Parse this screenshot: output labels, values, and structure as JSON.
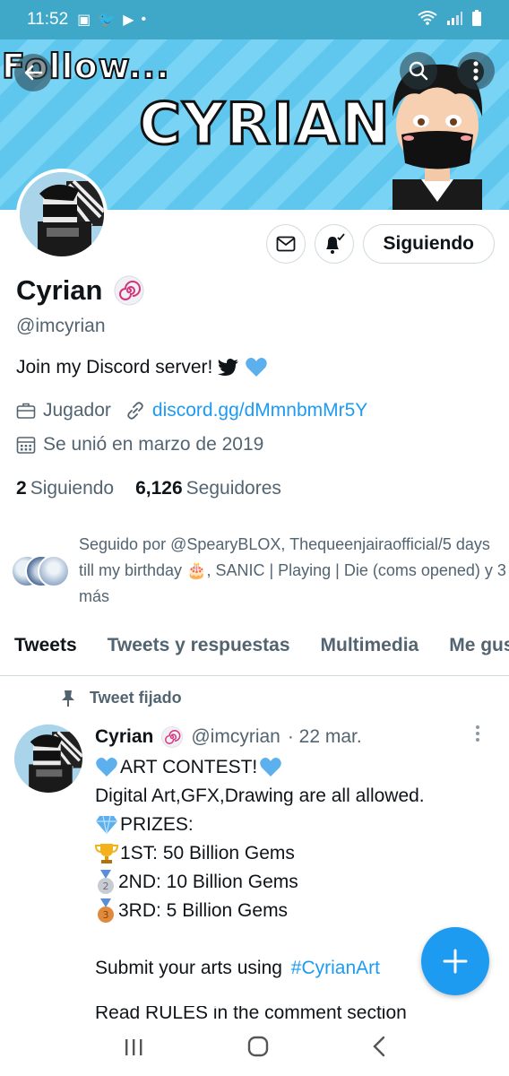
{
  "status_bar": {
    "time": "11:52"
  },
  "banner": {
    "follow_text": "Follow...",
    "name_text": "CYRIAN"
  },
  "actions": {
    "following_label": "Siguiendo"
  },
  "profile": {
    "name": "Cyrian",
    "handle": "@imcyrian",
    "bio": "Join my Discord server!",
    "category": "Jugador",
    "link": "discord.gg/dMmnbmMr5Y",
    "joined": "Se unió en marzo de 2019",
    "following_count": "2",
    "following_label": "Siguiendo",
    "followers_count": "6,126",
    "followers_label": "Seguidores",
    "followed_by": "Seguido por @SpearyBLOX, Thequeenjairaofficial/5 days till my birthday 🎂, SANIC | Playing | Die (coms opened) y 3 más"
  },
  "tabs": [
    {
      "label": "Tweets"
    },
    {
      "label": "Tweets y respuestas"
    },
    {
      "label": "Multimedia"
    },
    {
      "label": "Me gusta"
    }
  ],
  "tweet": {
    "pinned_label": "Tweet fijado",
    "name": "Cyrian",
    "handle": "@imcyrian",
    "date": "· 22 mar.",
    "lines": [
      "ART CONTEST!",
      "Digital Art,GFX,Drawing are all allowed.",
      "PRIZES:",
      "1ST: 50 Billion Gems",
      "2ND: 10 Billion Gems",
      "3RD: 5 Billion Gems",
      "Submit your arts using",
      "#CyrianArt",
      "Read RULES in the comment section"
    ]
  },
  "colors": {
    "accent": "#1d9bf0",
    "text": "#0f1419",
    "muted": "#536471"
  }
}
